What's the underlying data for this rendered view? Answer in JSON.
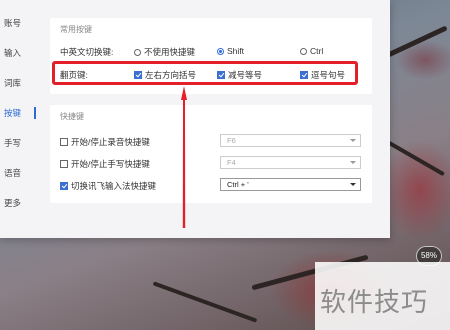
{
  "sidebar": {
    "items": [
      {
        "label": "账号"
      },
      {
        "label": "输入"
      },
      {
        "label": "词库"
      },
      {
        "label": "按键"
      },
      {
        "label": "手写"
      },
      {
        "label": "语音"
      },
      {
        "label": "更多"
      }
    ],
    "active_index": 3
  },
  "common_keys": {
    "title": "常用按键",
    "switch_row": {
      "label": "中英文切换键:",
      "options": [
        {
          "label": "不使用快捷键",
          "selected": false
        },
        {
          "label": "Shift",
          "selected": true
        },
        {
          "label": "Ctrl",
          "selected": false
        }
      ]
    },
    "page_row": {
      "label": "翻页键:",
      "options": [
        {
          "label": "左右方向括号",
          "checked": true
        },
        {
          "label": "减号等号",
          "checked": true
        },
        {
          "label": "逗号句号",
          "checked": true
        }
      ]
    }
  },
  "shortcuts": {
    "title": "快捷键",
    "rows": [
      {
        "label": "开始/停止录音快捷键",
        "checked": false,
        "value": "F6",
        "enabled": false
      },
      {
        "label": "开始/停止手写快捷键",
        "checked": false,
        "value": "F4",
        "enabled": false
      },
      {
        "label": "切换讯飞输入法快捷键",
        "checked": true,
        "value": "Ctrl + '",
        "enabled": true
      }
    ]
  },
  "badge": {
    "text": "58%"
  },
  "watermark": {
    "text": "软件技巧"
  },
  "colors": {
    "accent": "#2f6bd6",
    "highlight": "#e3202a"
  }
}
